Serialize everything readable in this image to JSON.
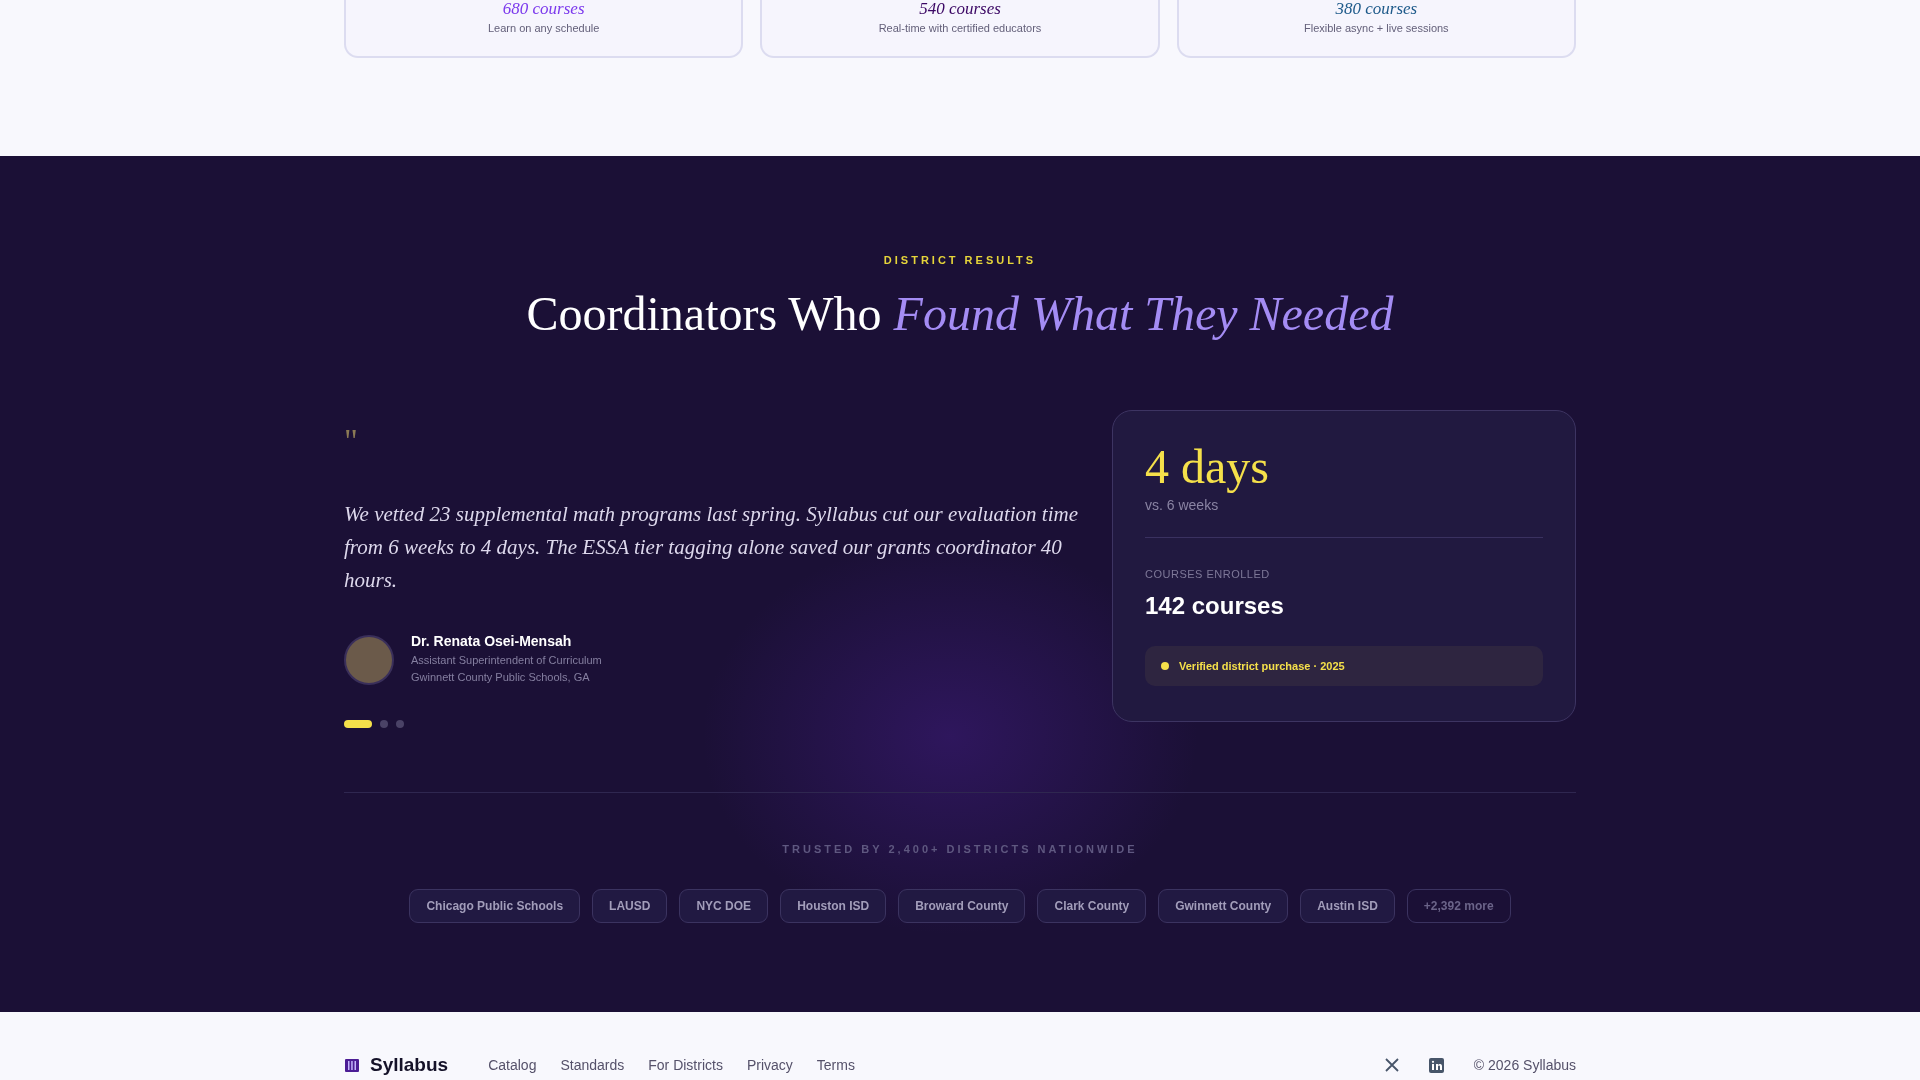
{
  "format_cards": [
    {
      "count": "680 courses",
      "description": "Learn on any schedule",
      "color": "#7c3aed"
    },
    {
      "count": "540 courses",
      "description": "Real-time with certified educators",
      "color": "#3b0764"
    },
    {
      "count": "380 courses",
      "description": "Flexible async + live sessions",
      "color": "#1e5a8a"
    }
  ],
  "results": {
    "eyebrow": "DISTRICT RESULTS",
    "heading": "Coordinators Who",
    "heading_accent": "Found What They Needed",
    "testimonial": {
      "quote_mark": "\"",
      "quote": "We vetted 23 supplemental math programs last spring. Syllabus cut our evaluation time from 6 weeks to 4 days. The ESSA tier tagging alone saved our grants coordinator 40 hours.",
      "author": "Dr. Renata Osei-Mensah",
      "role": "Assistant Superintendent of Curriculum",
      "organization": "Gwinnett County Public Schools, GA"
    },
    "carousel_dots": [
      {
        "selected": true
      },
      {
        "selected": false
      },
      {
        "selected": false
      }
    ],
    "stat_card": {
      "value": "4 days",
      "comparison": "vs. 6 weeks",
      "label": "COURSES ENROLLED",
      "count": "142 courses",
      "badge": "Verified district purchase · 2025"
    },
    "trusted_label": "TRUSTED BY 2,400+ DISTRICTS NATIONWIDE",
    "districts": [
      {
        "name": "Chicago Public Schools",
        "kind": "district"
      },
      {
        "name": "LAUSD",
        "kind": "district"
      },
      {
        "name": "NYC DOE",
        "kind": "district"
      },
      {
        "name": "Houston ISD",
        "kind": "district"
      },
      {
        "name": "Broward County",
        "kind": "district"
      },
      {
        "name": "Clark County",
        "kind": "district"
      },
      {
        "name": "Gwinnett County",
        "kind": "district"
      },
      {
        "name": "Austin ISD",
        "kind": "district"
      },
      {
        "name": "+2,392 more",
        "kind": "more"
      }
    ]
  },
  "footer": {
    "brand": "Syllabus",
    "links": [
      "Catalog",
      "Standards",
      "For Districts",
      "Privacy",
      "Terms"
    ],
    "copyright": "© 2026 Syllabus"
  }
}
